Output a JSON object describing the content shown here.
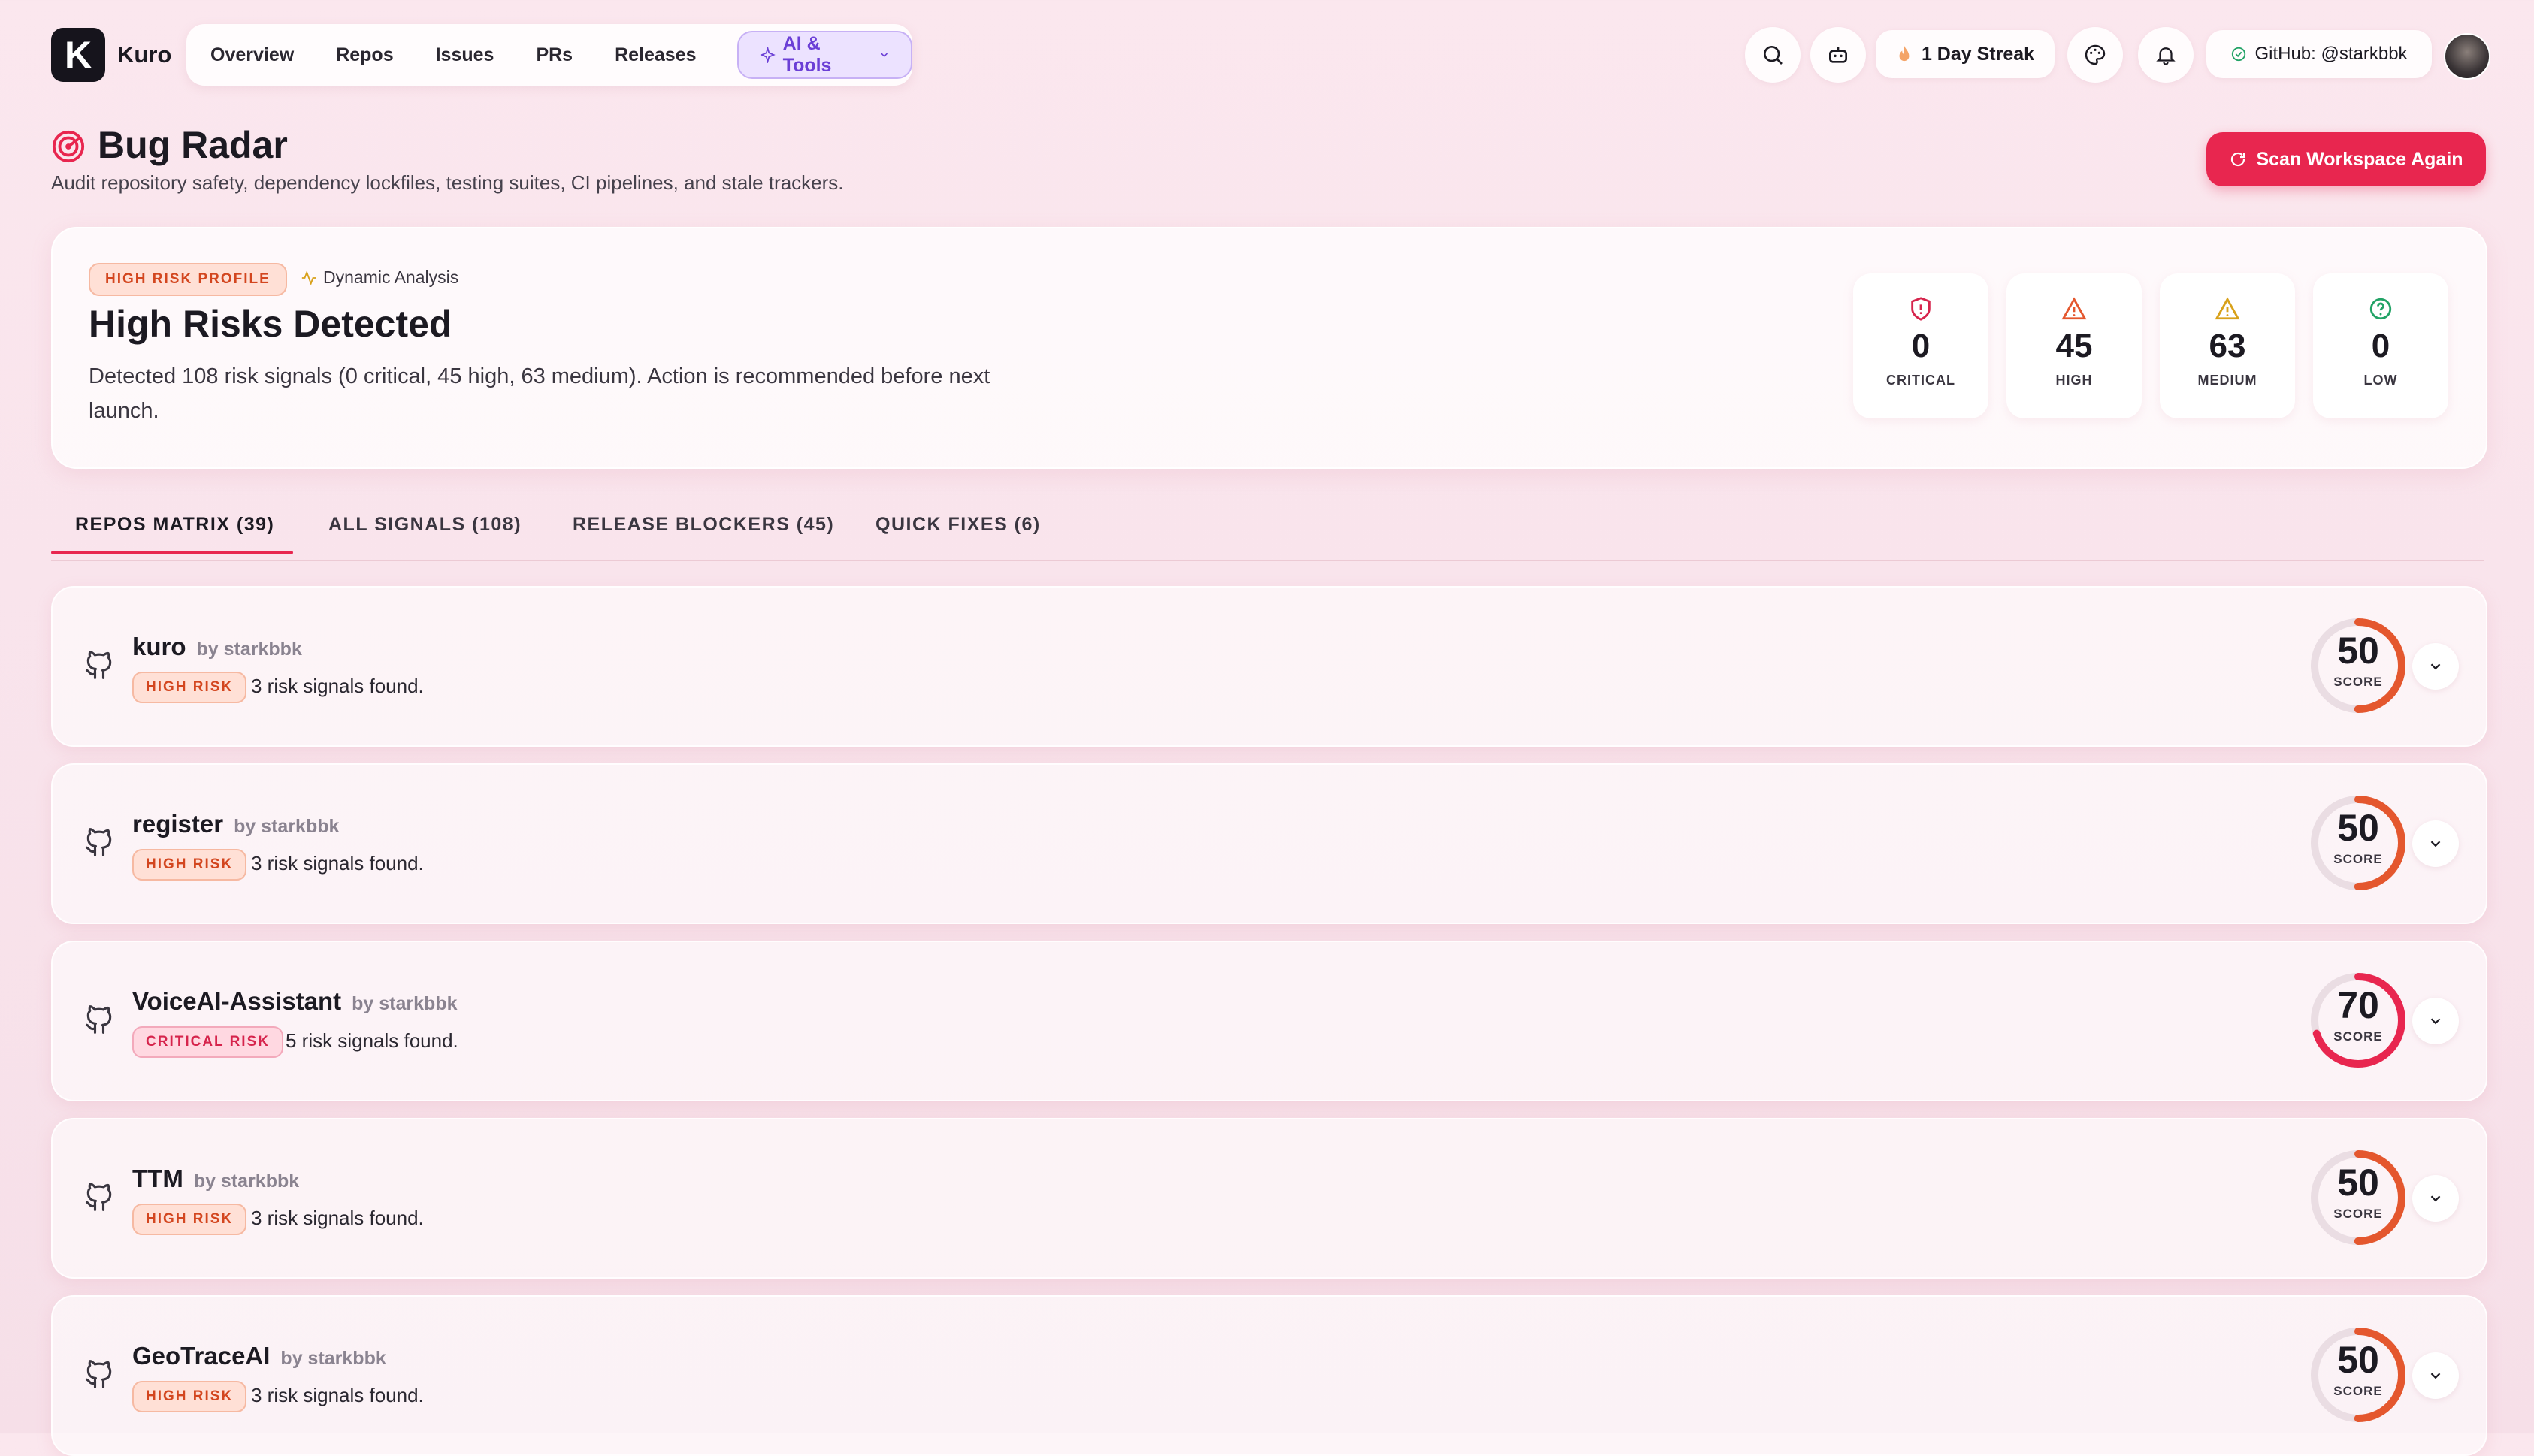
{
  "app": {
    "logo_letter": "K",
    "name": "Kuro"
  },
  "nav": {
    "items": [
      "Overview",
      "Repos",
      "Issues",
      "PRs",
      "Releases"
    ],
    "ai_tools": "AI & Tools"
  },
  "topbar": {
    "streak": "1 Day Streak",
    "github": "GitHub: @starkbbk"
  },
  "page": {
    "title": "Bug Radar",
    "subtitle": "Audit repository safety, dependency lockfiles, testing suites, CI pipelines, and stale trackers.",
    "scan_button": "Scan Workspace Again"
  },
  "summary": {
    "badge": "HIGH RISK PROFILE",
    "analysis": "Dynamic Analysis",
    "title": "High Risks Detected",
    "description": "Detected 108 risk signals (0 critical, 45 high, 63 medium). Action is recommended before next launch.",
    "stats": [
      {
        "value": "0",
        "label": "CRITICAL",
        "color": "#d6244c",
        "icon": "shield-alert-icon"
      },
      {
        "value": "45",
        "label": "HIGH",
        "color": "#e4572e",
        "icon": "warning-triangle-icon"
      },
      {
        "value": "63",
        "label": "MEDIUM",
        "color": "#d8a11a",
        "icon": "warning-triangle-icon"
      },
      {
        "value": "0",
        "label": "LOW",
        "color": "#22a366",
        "icon": "help-circle-icon"
      }
    ]
  },
  "tabs": [
    {
      "label": "REPOS MATRIX (39)",
      "active": true
    },
    {
      "label": "ALL SIGNALS (108)",
      "active": false
    },
    {
      "label": "RELEASE BLOCKERS (45)",
      "active": false
    },
    {
      "label": "QUICK FIXES (6)",
      "active": false
    }
  ],
  "repos": [
    {
      "name": "kuro",
      "owner": "by starkbbk",
      "risk": "HIGH RISK",
      "signals": "3 risk signals found.",
      "score": 50,
      "score_label": "SCORE"
    },
    {
      "name": "register",
      "owner": "by starkbbk",
      "risk": "HIGH RISK",
      "signals": "3 risk signals found.",
      "score": 50,
      "score_label": "SCORE"
    },
    {
      "name": "VoiceAI-Assistant",
      "owner": "by starkbbk",
      "risk": "CRITICAL RISK",
      "signals": "5 risk signals found.",
      "score": 70,
      "score_label": "SCORE"
    },
    {
      "name": "TTM",
      "owner": "by starkbbk",
      "risk": "HIGH RISK",
      "signals": "3 risk signals found.",
      "score": 50,
      "score_label": "SCORE"
    },
    {
      "name": "GeoTraceAI",
      "owner": "by starkbbk",
      "risk": "HIGH RISK",
      "signals": "3 risk signals found.",
      "score": 50,
      "score_label": "SCORE"
    }
  ],
  "colors": {
    "accent": "#e8264f",
    "high": "#e4572e",
    "critical": "#e8264f",
    "ai": "#6b3fd6"
  }
}
